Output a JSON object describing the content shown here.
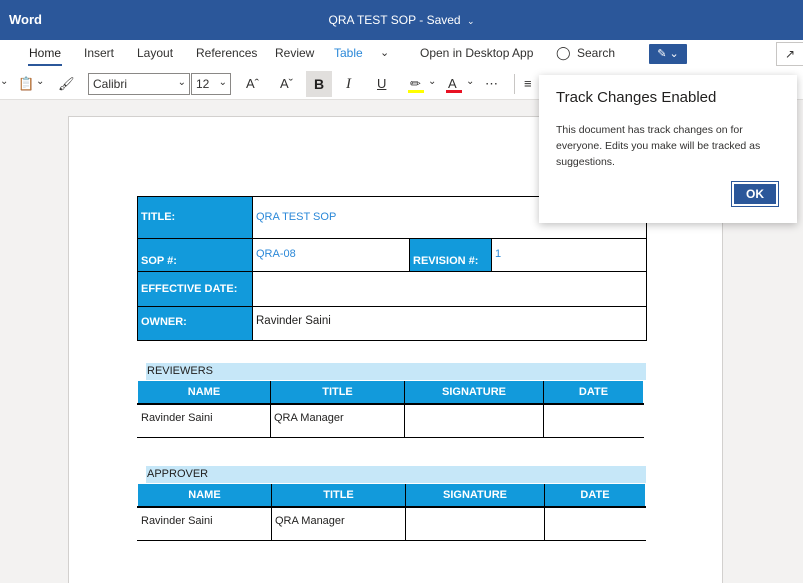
{
  "app": {
    "name": "Word",
    "doc_title": "QRA TEST SOP",
    "status": "Saved"
  },
  "tabs": [
    {
      "label": "Home",
      "active": true
    },
    {
      "label": "Insert"
    },
    {
      "label": "Layout"
    },
    {
      "label": "References"
    },
    {
      "label": "Review"
    },
    {
      "label": "Table",
      "contextual": true
    }
  ],
  "ribbon": {
    "open_desktop": "Open in Desktop App",
    "search_label": "Search",
    "font_name": "Calibri",
    "font_size": "12"
  },
  "document": {
    "header_table": {
      "title_label": "TITLE:",
      "title_value": "QRA TEST SOP",
      "sop_label": "SOP #:",
      "sop_value": "QRA-08",
      "revision_label": "REVISION #:",
      "revision_value": "1",
      "effective_label": "EFFECTIVE DATE:",
      "effective_value": "",
      "owner_label": "OWNER:",
      "owner_value": "Ravinder Saini"
    },
    "reviewers": {
      "heading": "REVIEWERS",
      "columns": [
        "NAME",
        "TITLE",
        "SIGNATURE",
        "DATE"
      ],
      "row": [
        "Ravinder Saini",
        "QRA Manager",
        "",
        ""
      ]
    },
    "approver": {
      "heading": "APPROVER",
      "columns": [
        "NAME",
        "TITLE",
        "SIGNATURE",
        "DATE"
      ],
      "row": [
        "Ravinder Saini",
        "QRA Manager",
        "",
        ""
      ]
    }
  },
  "popup": {
    "title": "Track Changes Enabled",
    "body": "This document has track changes on for everyone. Edits you make will be tracked as suggestions.",
    "ok_label": "OK"
  },
  "colors": {
    "brand": "#2b579a",
    "table_header": "#129adb",
    "band": "#c6e7f8",
    "link": "#2b88d8"
  }
}
